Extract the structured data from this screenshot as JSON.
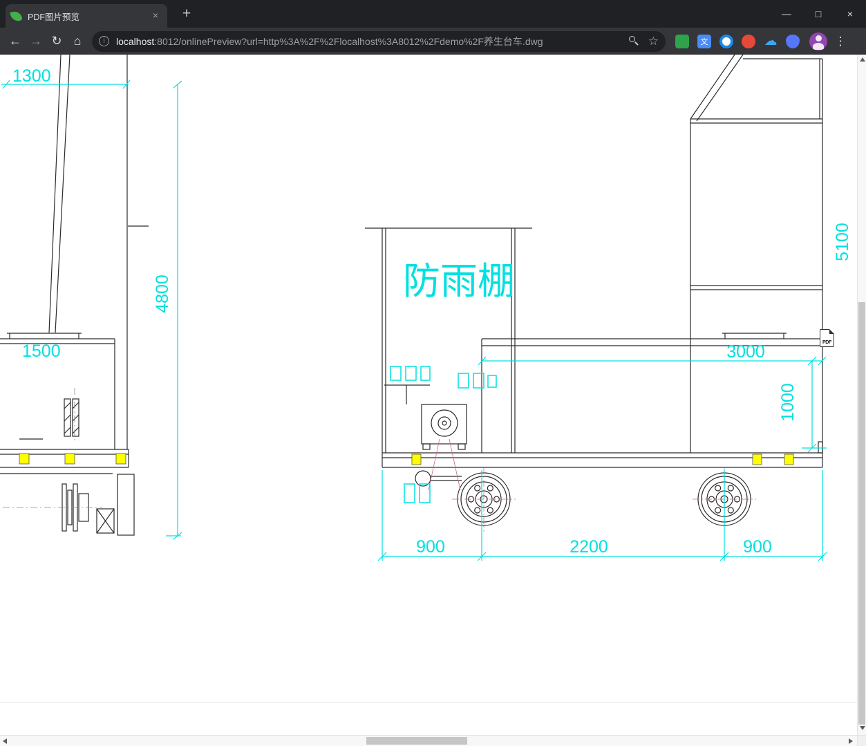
{
  "window_controls": {
    "minimize": "—",
    "maximize": "□",
    "close": "×"
  },
  "tabbar": {
    "tab_title": "PDF图片预览",
    "tab_close_glyph": "×",
    "new_tab_glyph": "+"
  },
  "toolbar": {
    "back_glyph": "←",
    "forward_glyph": "→",
    "reload_glyph": "↻",
    "home_glyph": "⌂",
    "info_glyph": "i",
    "url_host": "localhost",
    "url_path": ":8012/onlinePreview?url=http%3A%2F%2Flocalhost%3A8012%2Fdemo%2F养生台车.dwg",
    "bookmark_glyph": "☆",
    "translate_glyph": "文",
    "cloud_glyph": "☁",
    "menu_glyph": "⋮"
  },
  "drawing": {
    "rain_shelter_label": "防雨棚",
    "dims": {
      "left_top": "1300",
      "left_height": "4800",
      "left_width": "1500",
      "right_height": "5100",
      "body_length": "3000",
      "body_height": "1000",
      "span_left": "900",
      "span_center": "2200",
      "span_right": "900"
    },
    "pdf_icon_label": "PDF",
    "colors": {
      "dimension_cyan": "#00e0e0",
      "highlight_yellow": "#ffff00",
      "line_black": "#2a2a2a",
      "leader_pink": "#cc6688"
    }
  }
}
